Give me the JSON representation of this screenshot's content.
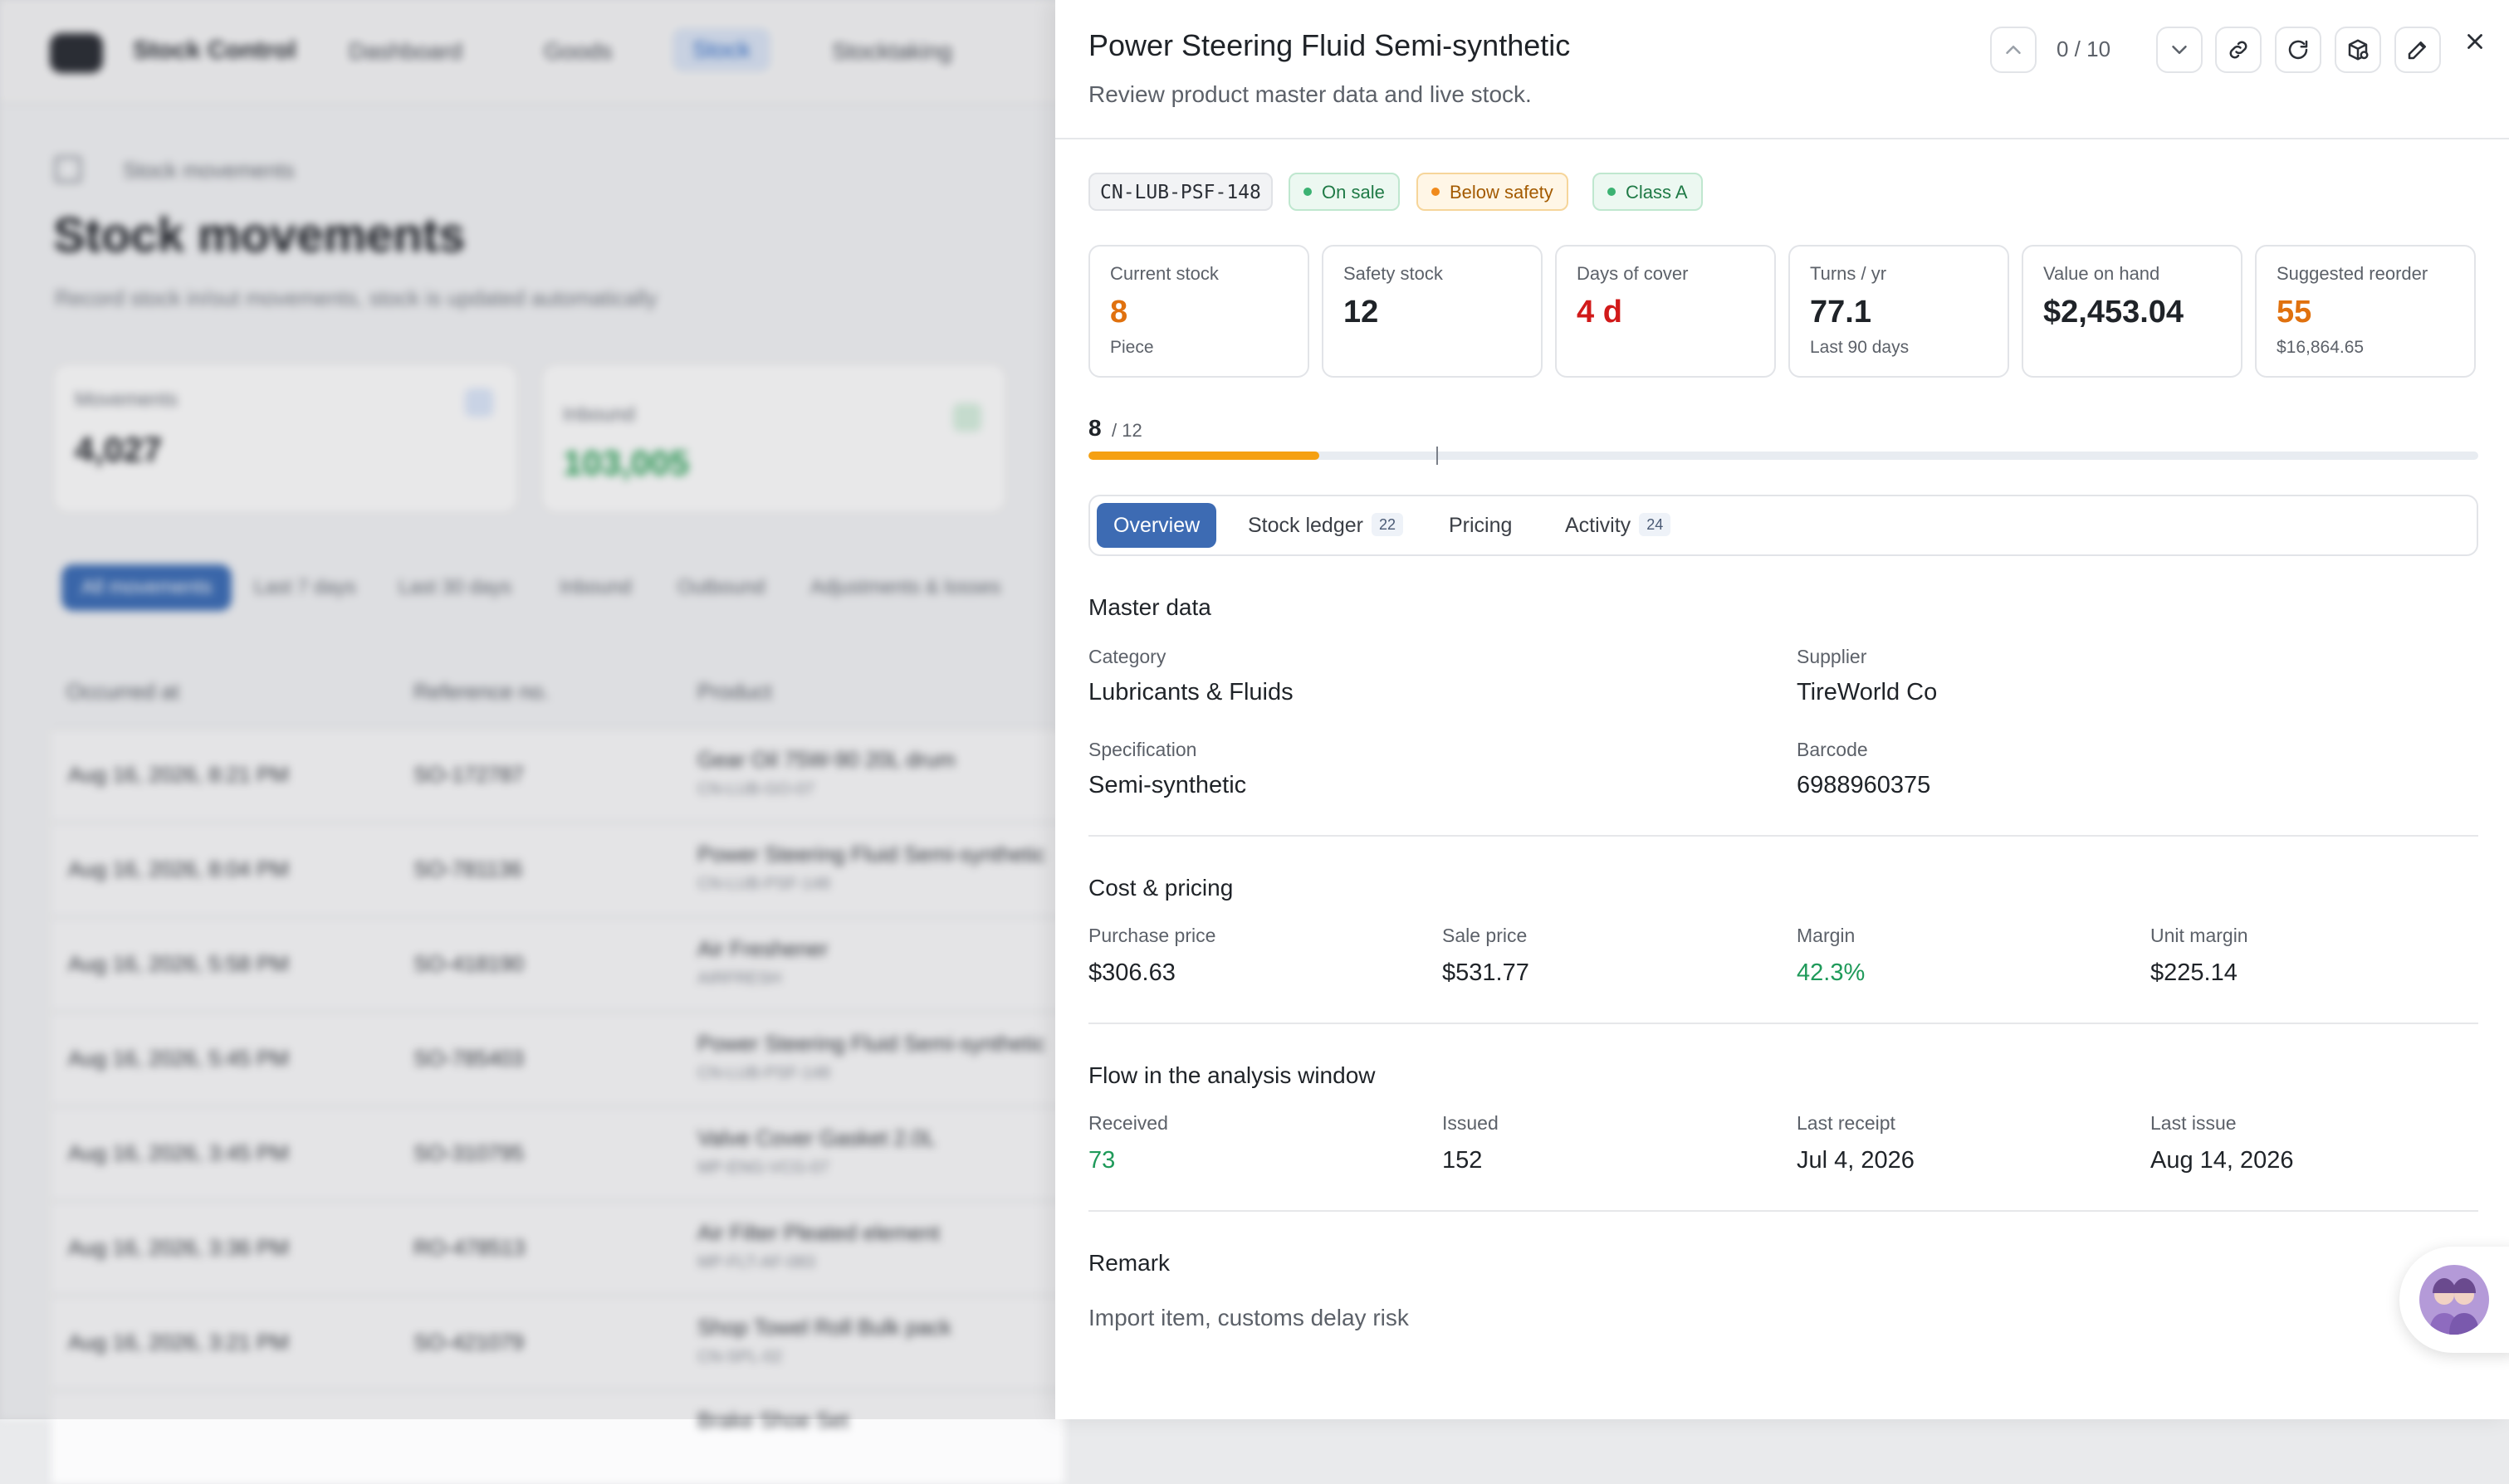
{
  "background": {
    "brand": "Stock Control",
    "nav": [
      "Dashboard",
      "Goods",
      "Stock",
      "Stocktaking"
    ],
    "breadcrumb": "Stock movements",
    "title": "Stock movements",
    "subtitle": "Record stock in/out movements, stock is updated automatically",
    "kpis": [
      {
        "label": "Movements",
        "value": "4,027"
      },
      {
        "label": "Inbound",
        "value": "103,005"
      }
    ],
    "filters": [
      "All movements",
      "Last 7 days",
      "Last 30 days",
      "Inbound",
      "Outbound",
      "Adjustments & losses"
    ],
    "columns": [
      "Occurred at",
      "Reference no.",
      "Product"
    ],
    "rows": [
      {
        "date": "Aug 16, 2026, 8:21 PM",
        "ref": "SO-172787",
        "product": "Gear Oil 75W-90 20L drum",
        "sku": "CN-LUB-GO-07"
      },
      {
        "date": "Aug 16, 2026, 8:04 PM",
        "ref": "SO-781136",
        "product": "Power Steering Fluid Semi-synthetic",
        "sku": "CN-LUB-PSF-148"
      },
      {
        "date": "Aug 16, 2026, 5:58 PM",
        "ref": "SO-418190",
        "product": "Air Freshener",
        "sku": "AIRFRESH"
      },
      {
        "date": "Aug 16, 2026, 5:45 PM",
        "ref": "SO-785403",
        "product": "Power Steering Fluid Semi-synthetic",
        "sku": "CN-LUB-PSF-148"
      },
      {
        "date": "Aug 16, 2026, 3:45 PM",
        "ref": "SO-310795",
        "product": "Valve Cover Gasket 2.0L",
        "sku": "MP-ENG-VCG-07"
      },
      {
        "date": "Aug 16, 2026, 3:36 PM",
        "ref": "RO-478513",
        "product": "Air Filter Pleated element",
        "sku": "MP-FLT-AF-083"
      },
      {
        "date": "Aug 16, 2026, 3:21 PM",
        "ref": "SO-421079",
        "product": "Shop Towel Roll Bulk pack",
        "sku": "CN-SPL-02"
      },
      {
        "date": "",
        "ref": "",
        "product": "Brake Shoe Set",
        "sku": ""
      }
    ]
  },
  "drawer": {
    "title": "Power Steering Fluid Semi-synthetic",
    "subtitle": "Review product master data and live stock.",
    "counter": "0 / 10",
    "tags": {
      "code": "CN-LUB-PSF-148",
      "status": "On sale",
      "alert": "Below safety",
      "class": "Class A"
    },
    "metrics": [
      {
        "label": "Current stock",
        "value": "8",
        "caption": "Piece",
        "tone": "orange"
      },
      {
        "label": "Safety stock",
        "value": "12",
        "caption": "",
        "tone": "normal"
      },
      {
        "label": "Days of cover",
        "value": "4 d",
        "caption": "",
        "tone": "red"
      },
      {
        "label": "Turns / yr",
        "value": "77.1",
        "caption": "Last 90 days",
        "tone": "normal"
      },
      {
        "label": "Value on hand",
        "value": "$2,453.04",
        "caption": "",
        "tone": "normal"
      },
      {
        "label": "Suggested reorder",
        "value": "55",
        "caption": "$16,864.65",
        "tone": "orange"
      }
    ],
    "progress": {
      "current": "8",
      "of": "/ 12",
      "fill_fraction": 0.166,
      "marker_fraction": 0.25
    },
    "tabs": [
      {
        "label": "Overview",
        "count": "",
        "active": true
      },
      {
        "label": "Stock ledger",
        "count": "22",
        "active": false
      },
      {
        "label": "Pricing",
        "count": "",
        "active": false
      },
      {
        "label": "Activity",
        "count": "24",
        "active": false
      }
    ],
    "master_data": {
      "title": "Master data",
      "category_label": "Category",
      "category": "Lubricants & Fluids",
      "supplier_label": "Supplier",
      "supplier": "TireWorld Co",
      "spec_label": "Specification",
      "spec": "Semi-synthetic",
      "barcode_label": "Barcode",
      "barcode": "6988960375"
    },
    "pricing": {
      "title": "Cost & pricing",
      "purchase_label": "Purchase price",
      "purchase": "$306.63",
      "sale_label": "Sale price",
      "sale": "$531.77",
      "margin_label": "Margin",
      "margin": "42.3%",
      "unit_margin_label": "Unit margin",
      "unit_margin": "$225.14"
    },
    "flow": {
      "title": "Flow in the analysis window",
      "received_label": "Received",
      "received": "73",
      "issued_label": "Issued",
      "issued": "152",
      "last_receipt_label": "Last receipt",
      "last_receipt": "Jul 4, 2026",
      "last_issue_label": "Last issue",
      "last_issue": "Aug 14, 2026"
    },
    "remark": {
      "title": "Remark",
      "text": "Import item, customs delay risk"
    }
  },
  "colors": {
    "accent": "#3d6bb3",
    "warning": "#e0710e",
    "danger": "#d11a1a",
    "success": "#1f9a5a",
    "progress": "#f5a012"
  },
  "icons": [
    "chevron-up-icon",
    "chevron-down-icon",
    "link-icon",
    "refresh-icon",
    "package-icon",
    "edit-icon",
    "close-icon",
    "help-avatar-icon"
  ]
}
